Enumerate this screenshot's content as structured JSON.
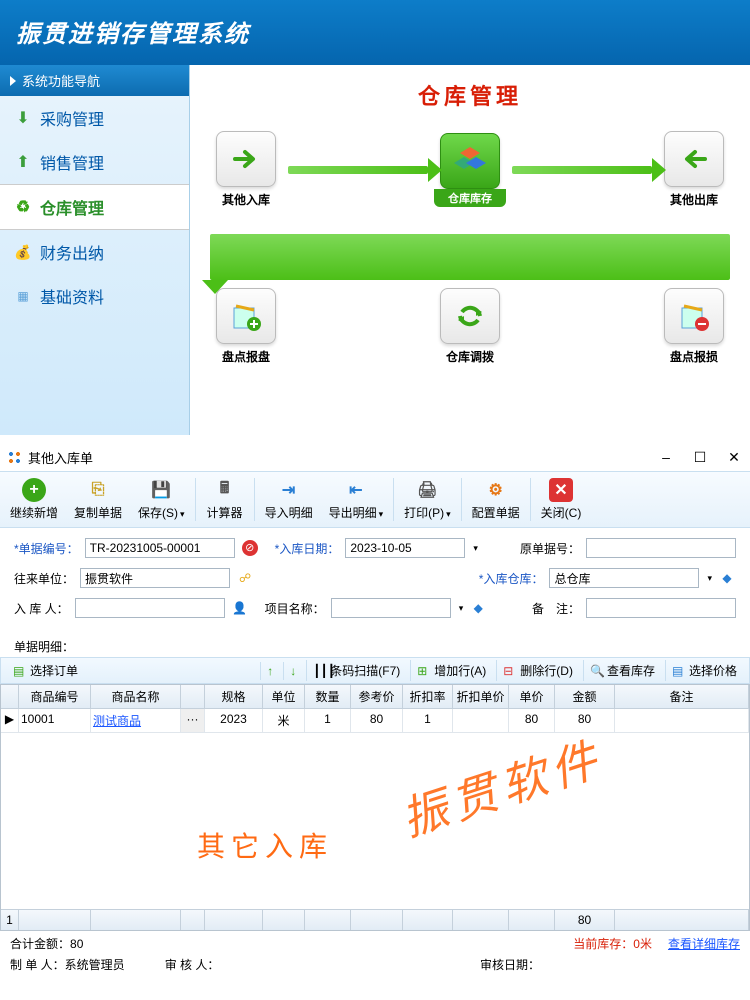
{
  "app": {
    "title": "振贯进销存管理系统"
  },
  "sidebar": {
    "header": "系统功能导航",
    "items": [
      {
        "label": "采购管理",
        "icon": "arrow-down"
      },
      {
        "label": "销售管理",
        "icon": "arrow-up"
      },
      {
        "label": "仓库管理",
        "icon": "recycle",
        "active": true
      },
      {
        "label": "财务出纳",
        "icon": "coin"
      },
      {
        "label": "基础资料",
        "icon": "grid"
      }
    ]
  },
  "section": {
    "title": "仓库管理",
    "cards": {
      "other_in": "其他入库",
      "stock": "仓库库存",
      "other_out": "其他出库",
      "check_gain": "盘点报盘",
      "transfer": "仓库调拨",
      "check_loss": "盘点报损"
    }
  },
  "window": {
    "title": "其他入库单",
    "controls": {
      "min": "–",
      "max": "☐",
      "close": "✕"
    }
  },
  "toolbar": {
    "new": "继续新增",
    "copy": "复制单据",
    "save": "保存(S)",
    "calc": "计算器",
    "import": "导入明细",
    "export": "导出明细",
    "print": "打印(P)",
    "config": "配置单据",
    "close": "关闭(C)"
  },
  "form": {
    "doc_no_label": "*单据编号：",
    "doc_no": "TR-20231005-00001",
    "in_date_label": "*入库日期：",
    "in_date": "2023-10-05",
    "orig_no_label": "原单据号：",
    "orig_no": "",
    "vendor_label": "往来单位：",
    "vendor": "振贯软件",
    "warehouse_label": "*入库仓库：",
    "warehouse": "总仓库",
    "operator_label": "入 库 人：",
    "operator": "",
    "project_label": "项目名称：",
    "project": "",
    "remark_label": "备　注：",
    "remark": ""
  },
  "detail": {
    "label": "单据明细：",
    "tools": {
      "select_order": "选择订单",
      "barcode": "条码扫描(F7)",
      "add_row": "增加行(A)",
      "del_row": "删除行(D)",
      "check_stock": "查看库存",
      "select_price": "选择价格"
    },
    "columns": [
      "",
      "商品编号",
      "商品名称",
      "",
      "规格",
      "单位",
      "数量",
      "参考价",
      "折扣率",
      "折扣单价",
      "单价",
      "金额",
      "备注"
    ],
    "rows": [
      {
        "row_marker": "▶",
        "code": "10001",
        "name": "测试商品",
        "dots": "···",
        "spec": "2023",
        "unit": "米",
        "qty": "1",
        "ref_price": "80",
        "disc_rate": "1",
        "disc_price": "",
        "price": "80",
        "amount": "80",
        "remark": ""
      }
    ],
    "foot_index": "1",
    "foot_amount": "80",
    "watermark1": "其它入库",
    "watermark2": "振贯软件"
  },
  "footer": {
    "total_label": "合计金额：",
    "total": "80",
    "stock_label": "当前库存：",
    "stock": "0米",
    "detail_link": "查看详细库存",
    "maker_label": "制 单 人：",
    "maker": "系统管理员",
    "auditor_label": "审 核 人：",
    "auditor": "",
    "audit_date_label": "审核日期："
  }
}
